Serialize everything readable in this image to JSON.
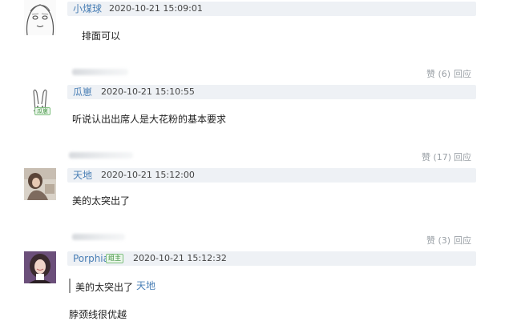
{
  "comments": [
    {
      "username": "小煤球",
      "timestamp": "2020-10-21 15:09:01",
      "text": "排面可以",
      "avatar_icon": "sketch-face-icon"
    },
    {
      "username": "瓜崽",
      "timestamp": "2020-10-21 15:10:55",
      "text": "听说认出出席人是大花粉的基本要求",
      "avatar_icon": "bunny-icon",
      "avatar_badge": "瓜崽",
      "like_label": "赞",
      "like_count": "(6)",
      "reply_label": "回应"
    },
    {
      "username": "天地",
      "timestamp": "2020-10-21 15:12:00",
      "text": "美的太突出了",
      "avatar_icon": "photo-avatar-icon",
      "like_label": "赞",
      "like_count": "(17)",
      "reply_label": "回应"
    },
    {
      "username": "Porphia",
      "badge": "组主",
      "timestamp": "2020-10-21 15:12:32",
      "quote_text": "美的太突出了",
      "quote_author": "天地",
      "text": "脖颈线很优越",
      "avatar_icon": "photo-avatar-icon",
      "like_label": "赞",
      "like_count": "(3)",
      "reply_label": "回应"
    }
  ],
  "colors": {
    "link": "#4a7fb5",
    "header_bg": "#eef1f5",
    "action_gray": "#9aa0a6",
    "badge_green": "#3b8d3b"
  }
}
